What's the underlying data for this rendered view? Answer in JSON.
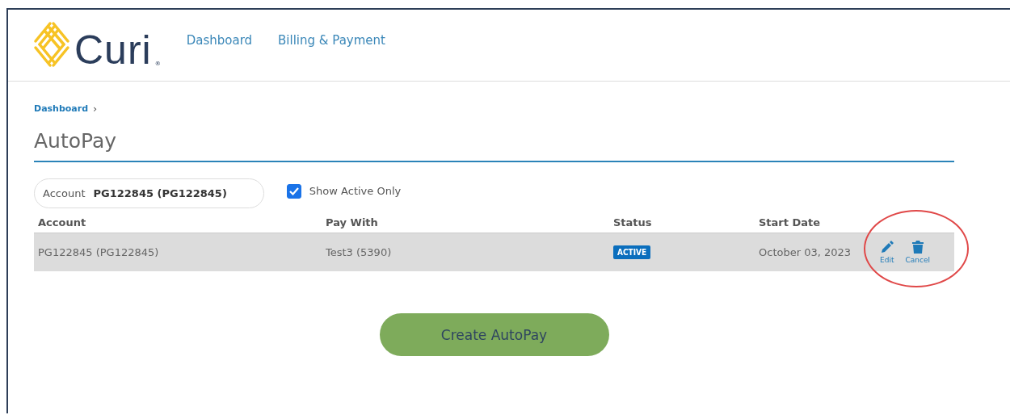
{
  "header": {
    "logo": {
      "wordmark": "Curi",
      "registered": "®"
    },
    "nav": [
      {
        "label": "Dashboard"
      },
      {
        "label": "Billing & Payment"
      }
    ]
  },
  "breadcrumb": {
    "link": "Dashboard",
    "separator": "›"
  },
  "title": "AutoPay",
  "filters": {
    "account": {
      "label": "Account",
      "value": "PG122845 (PG122845)"
    },
    "show_active": {
      "label": "Show Active Only",
      "checked": true
    }
  },
  "table": {
    "columns": [
      "Account",
      "Pay With",
      "Status",
      "Start Date"
    ],
    "rows": [
      {
        "account": "PG122845 (PG122845)",
        "pay_with": "Test3 (5390)",
        "status": "ACTIVE",
        "start_date": "October 03, 2023",
        "actions": [
          {
            "kind": "edit",
            "label": "Edit"
          },
          {
            "kind": "cancel",
            "label": "Cancel"
          }
        ],
        "highlighted": true
      }
    ]
  },
  "create_button": "Create AutoPay"
}
